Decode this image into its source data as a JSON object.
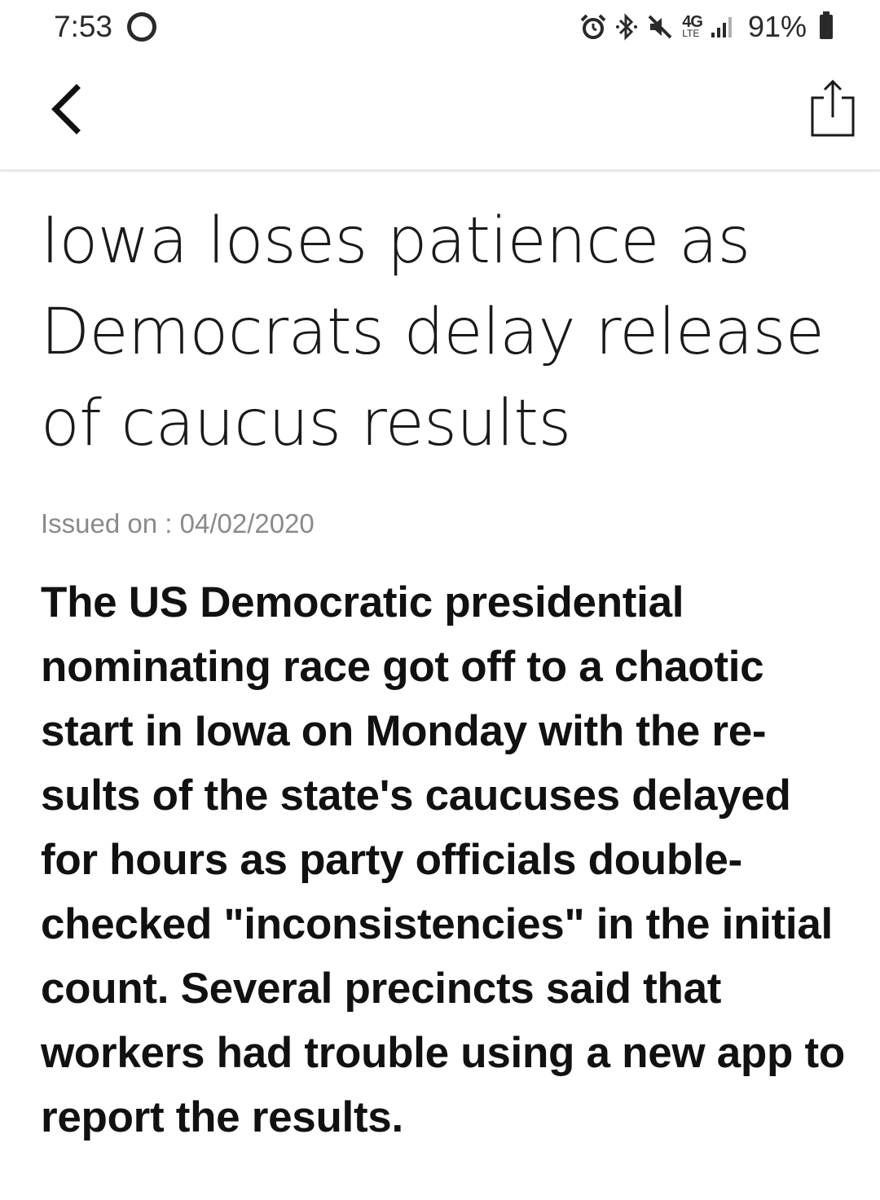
{
  "status_bar": {
    "time": "7:53",
    "network_label": "4G",
    "network_sub": "LTE",
    "battery_percent": "91%",
    "icons": [
      "alarm-icon",
      "bluetooth-icon",
      "mute-icon",
      "network-4g-icon",
      "signal-icon",
      "battery-icon"
    ]
  },
  "toolbar": {
    "back_icon": "chevron-left-icon",
    "share_icon": "share-icon"
  },
  "article": {
    "title": "Iowa loses patience as Democrats delay release of caucus results",
    "issued_label": "Issued on : 04/02/2020",
    "lead": "The US Democratic presidential nominating race got off to a chaotic start in Iowa on Monday with the re­sults of the state's caucuses delayed for hours as party officials double-checked \"inconsistencies\" in the initial count. Several precincts said that workers had trouble using a new app to report the results."
  },
  "colors": {
    "background": "#ffffff",
    "text": "#111111",
    "muted_text": "#8a8a8a",
    "divider": "#e6e6e6"
  }
}
